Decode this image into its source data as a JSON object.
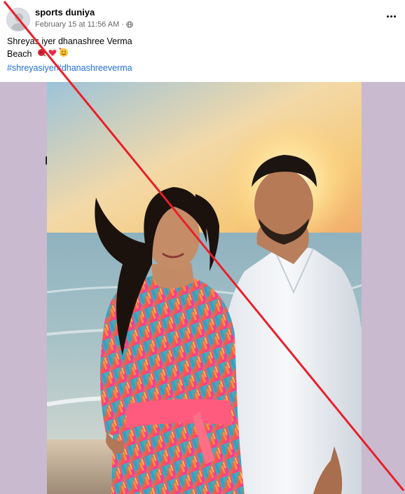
{
  "post": {
    "author": "sports duniya",
    "date": "February 15 at 11:56 AM",
    "privacy_icon": "globe-icon",
    "caption_line1": "Shreyas iyer dhanashree Verma",
    "caption_line2": "Beach",
    "caption_emojis": [
      "rose",
      "heart",
      "smiling-face-with-hearts"
    ],
    "hashtags": [
      "#shreyasiyer",
      "#dhanashreeverma"
    ],
    "menu_icon": "more-options-icon"
  },
  "colors": {
    "link": "#216fdb",
    "media_background": "#c9bad0",
    "cross_line": "#e8202a"
  }
}
